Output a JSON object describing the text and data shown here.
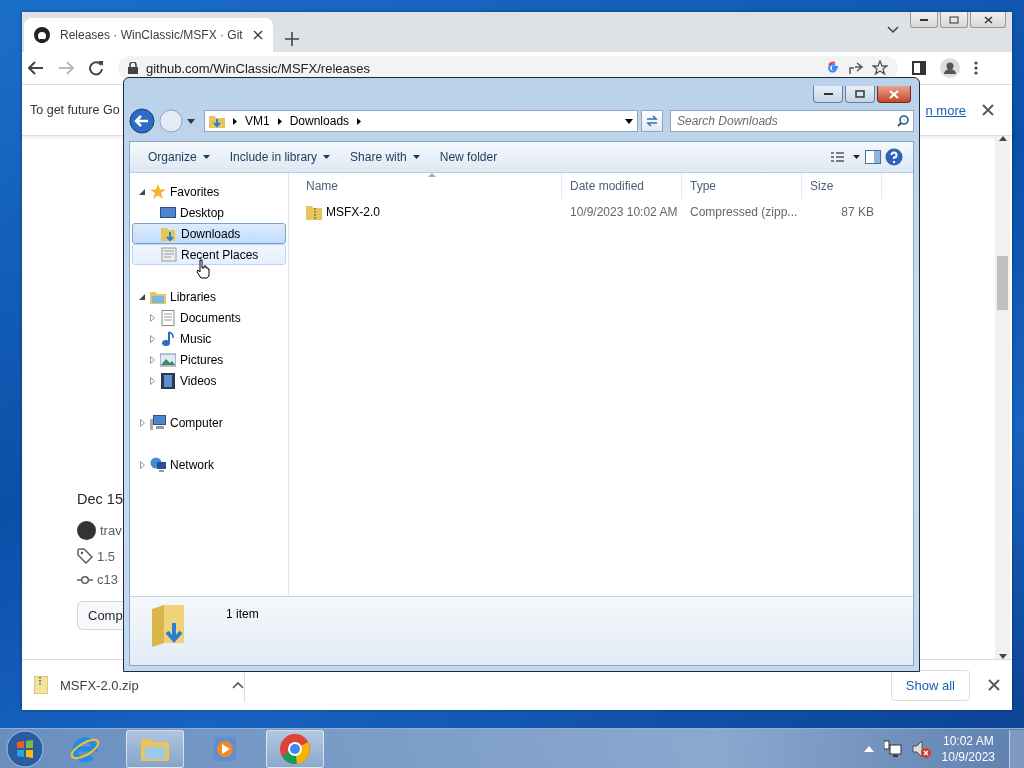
{
  "browser": {
    "tab": {
      "title": "Releases · WinClassic/MSFX · Git",
      "selected": true
    },
    "address": "github.com/WinClassic/MSFX/releases",
    "infobar": {
      "text": "To get future Go",
      "link": "n more"
    },
    "page": {
      "date": "Dec 15",
      "author": "trav",
      "tag": "1.5",
      "commit": "c13",
      "button": "Comp"
    },
    "downloads": {
      "file": "MSFX-2.0.zip",
      "show_all": "Show all"
    }
  },
  "explorer": {
    "path": [
      "VM1",
      "Downloads"
    ],
    "search": {
      "placeholder": "Search Downloads"
    },
    "toolbar": [
      {
        "label": "Organize",
        "dropdown": true
      },
      {
        "label": "Include in library",
        "dropdown": true
      },
      {
        "label": "Share with",
        "dropdown": true
      },
      {
        "label": "New folder",
        "dropdown": false
      }
    ],
    "nav": [
      {
        "label": "Favorites",
        "kind": "favorites",
        "expanded": true,
        "children": [
          {
            "label": "Desktop",
            "kind": "desktop",
            "selected": false,
            "hovered": false
          },
          {
            "label": "Downloads",
            "kind": "downloads",
            "selected": true,
            "hovered": false
          },
          {
            "label": "Recent Places",
            "kind": "recent",
            "selected": false,
            "hovered": true
          }
        ]
      },
      {
        "label": "Libraries",
        "kind": "libraries",
        "expanded": true,
        "children": [
          {
            "label": "Documents",
            "kind": "documents",
            "expanded": false
          },
          {
            "label": "Music",
            "kind": "music",
            "expanded": false
          },
          {
            "label": "Pictures",
            "kind": "pictures",
            "expanded": false
          },
          {
            "label": "Videos",
            "kind": "videos",
            "expanded": false
          }
        ]
      },
      {
        "label": "Computer",
        "kind": "computer",
        "expanded": false
      },
      {
        "label": "Network",
        "kind": "network",
        "expanded": false
      }
    ],
    "columns": [
      "Name",
      "Date modified",
      "Type",
      "Size"
    ],
    "rows": [
      {
        "name": "MSFX-2.0",
        "date": "10/9/2023 10:02 AM",
        "type": "Compressed (zipp...",
        "size": "87 KB"
      }
    ],
    "status": "1 item"
  },
  "taskbar": {
    "apps": [
      {
        "kind": "ie",
        "running": false
      },
      {
        "kind": "explorer",
        "running": true
      },
      {
        "kind": "media",
        "running": false
      },
      {
        "kind": "chrome",
        "running": true
      }
    ],
    "clock": {
      "time": "10:02 AM",
      "date": "10/9/2023"
    }
  }
}
